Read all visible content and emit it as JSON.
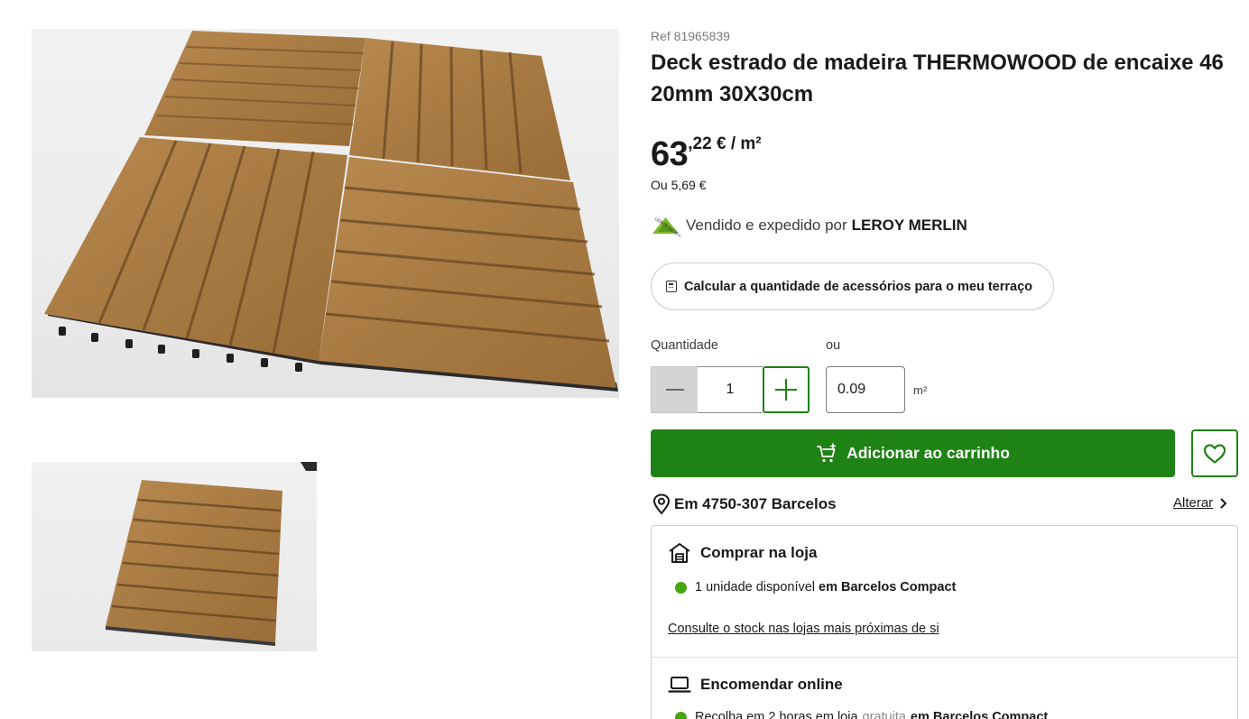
{
  "gallery": {
    "main_image": "wooden-deck-tile-photo",
    "thumbnail": "wooden-deck-tile-thumbnail"
  },
  "product": {
    "ref": "Ref 81965839",
    "title": "Deck estrado de madeira THERMOWOOD de encaixe 46 20mm 30X30cm",
    "price_integer": "63",
    "price_decimal": ",22 € / m²",
    "price_alt": "Ou 5,69 €"
  },
  "seller": {
    "logo_icon": "leroy-merlin-logo-icon",
    "prefix": "Vendido e expedido por",
    "name": "LEROY MERLIN"
  },
  "calc_button": {
    "icon": "calculator-icon",
    "label": "Calcular a quantidade de acessórios para o meu terraço"
  },
  "quantity": {
    "label": "Quantidade",
    "value": "1",
    "or_label": "ou",
    "area_value": "0.09",
    "area_unit": "m²"
  },
  "cart": {
    "label": "Adicionar ao carrinho",
    "icon": "cart-plus-icon"
  },
  "wishlist": {
    "icon": "heart-icon"
  },
  "location": {
    "text": "Em 4750-307 Barcelos",
    "change_label": "Alterar"
  },
  "store": {
    "heading": "Comprar na loja",
    "stock_text": "1 unidade disponível",
    "stock_store": "em Barcelos Compact",
    "stock_link": "Consulte o stock nas lojas mais próximas de si",
    "status_color": "#46a610"
  },
  "online": {
    "heading": "Encomendar online",
    "pickup_lead": "Recolha em 2 horas em loja",
    "pickup_free": "gratuita",
    "pickup_store": "em Barcelos Compact"
  },
  "colors": {
    "brand_green": "#1e8214",
    "available_dot": "#46a610"
  }
}
